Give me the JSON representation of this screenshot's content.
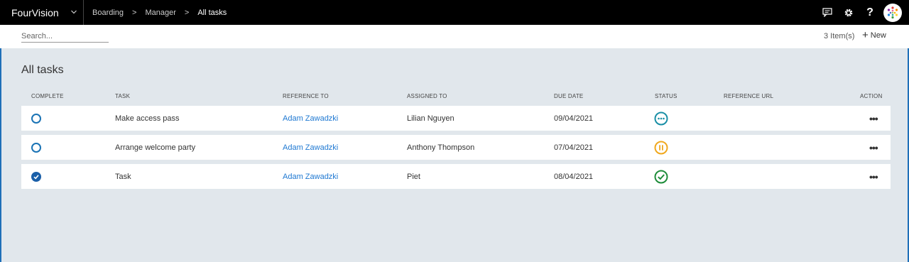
{
  "app": {
    "brand": "FourVision",
    "breadcrumbs": [
      "Boarding",
      "Manager",
      "All tasks"
    ]
  },
  "toolbar": {
    "search_placeholder": "Search...",
    "items_count": "3 Item(s)",
    "new_label": "New"
  },
  "page": {
    "title": "All tasks"
  },
  "table": {
    "columns": [
      "COMPLETE",
      "TASK",
      "REFERENCE TO",
      "ASSIGNED TO",
      "DUE DATE",
      "STATUS",
      "REFERENCE URL",
      "ACTION"
    ],
    "rows": [
      {
        "complete": false,
        "task": "Make access pass",
        "reference_to": "Adam Zawadzki",
        "assigned_to": "Lilian Nguyen",
        "due_date": "09/04/2021",
        "status": "not-started",
        "reference_url": ""
      },
      {
        "complete": false,
        "task": "Arrange welcome party",
        "reference_to": "Adam Zawadzki",
        "assigned_to": "Anthony Thompson",
        "due_date": "07/04/2021",
        "status": "on-hold",
        "reference_url": ""
      },
      {
        "complete": true,
        "task": "Task",
        "reference_to": "Adam Zawadzki",
        "assigned_to": "Piet",
        "due_date": "08/04/2021",
        "status": "completed",
        "reference_url": ""
      }
    ]
  },
  "colors": {
    "accent": "#1e78d2",
    "status_not_started": "#1a8fa6",
    "status_on_hold": "#f0a81e",
    "status_completed": "#1e8c3a"
  },
  "icons": {
    "chevron": "chevron-down-icon",
    "feedback": "feedback-icon",
    "settings": "gear-icon",
    "help": "help-icon",
    "avatar": "user-avatar",
    "more": "more-icon"
  }
}
